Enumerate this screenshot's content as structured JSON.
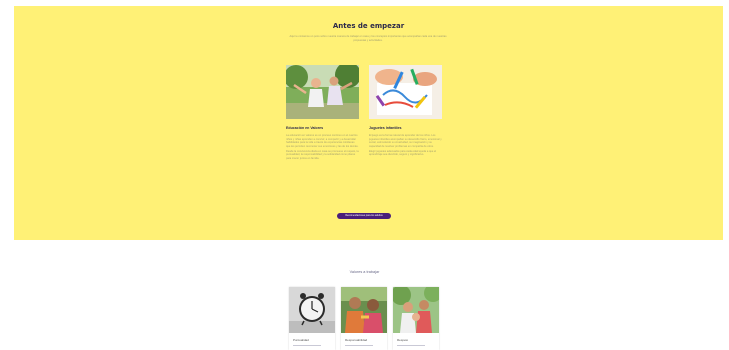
{
  "hero": {
    "title": "Antes de empezar",
    "intro": "Aquí te contamos un poco sobre nuestra manera de trabajar en casa y los conceptos importantes que acompañan cada una de nuestras propuestas y actividades.",
    "cta_label": "Recomendaciones para los adultos"
  },
  "columns": [
    {
      "title": "Educación en Valores",
      "paragraphs": [
        "La educación en valores es un proceso continuo en el cual los niños y niñas aprenden a convivir, a compartir y a desarrollar habilidades para la vida a través de experiencias cotidianas que les permiten reconocer sus emociones y las de los demás.",
        "Desde la convivencia diaria en casa se promueve el respeto, la puntualidad, la responsabilidad y la solidaridad como pilares para crecer juntos en familia."
      ]
    },
    {
      "title": "Juguetes Infantiles",
      "paragraphs": [
        "El juego es la forma natural de aprender de los niños. Los juguetes infantiles acompañan su desarrollo físico, emocional y social, estimulando su creatividad, su imaginación y su capacidad de resolver problemas en compañía de otros.",
        "Elegir juguetes adecuados para cada edad ayuda a que el aprendizaje sea divertido, seguro y significativo."
      ]
    }
  ],
  "values": {
    "title": "Valores a trabajar",
    "cards": [
      {
        "label": "Puntualidad",
        "icon": "clock-photo"
      },
      {
        "label": "Responsabilidad",
        "icon": "children-photo"
      },
      {
        "label": "Respeto",
        "icon": "kids-outdoor-photo"
      }
    ]
  },
  "colors": {
    "panel": "#fff176",
    "button": "#4a1f7a",
    "heading": "#2d2a4a"
  }
}
